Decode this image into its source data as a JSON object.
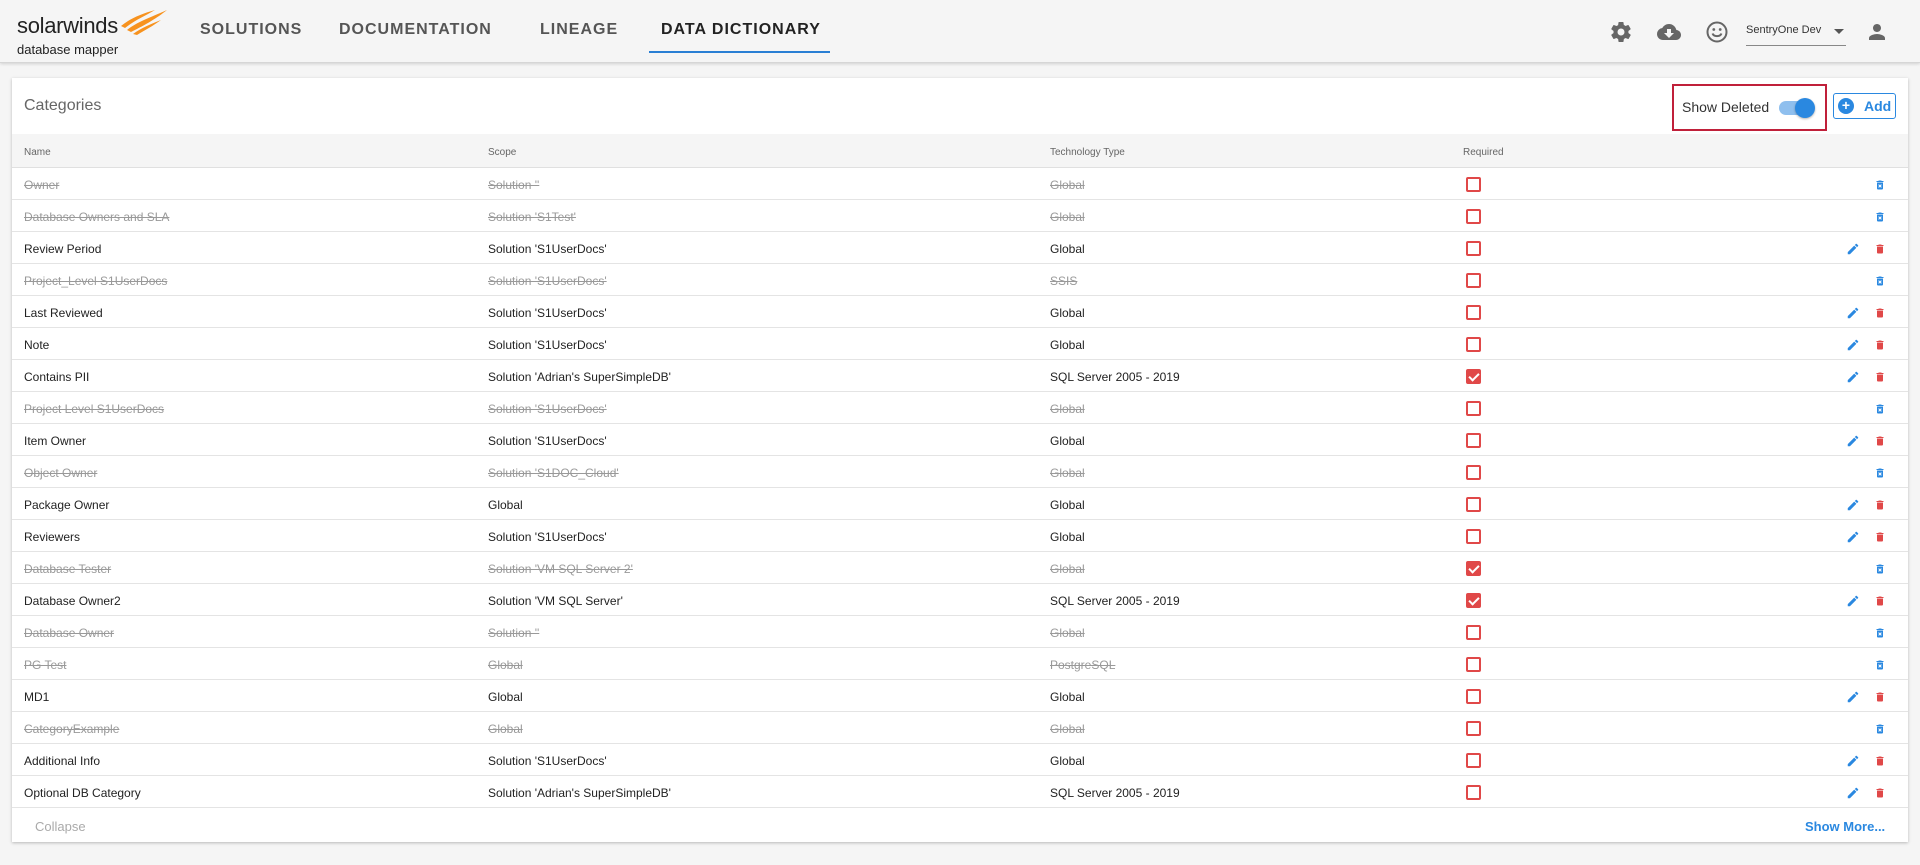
{
  "brand": {
    "name": "solarwinds",
    "product": "database mapper",
    "flame_color": "#f7921e"
  },
  "nav": {
    "items": [
      {
        "label": "SOLUTIONS"
      },
      {
        "label": "DOCUMENTATION"
      },
      {
        "label": "LINEAGE"
      },
      {
        "label": "DATA DICTIONARY",
        "active": true
      }
    ]
  },
  "topbar": {
    "icons": [
      "gear-icon",
      "cloud-download-icon",
      "smiley-icon",
      "person-icon"
    ],
    "user_select": "SentryOne Dev"
  },
  "categories": {
    "title": "Categories",
    "show_deleted_label": "Show Deleted",
    "show_deleted": true,
    "add_label": "Add",
    "columns": {
      "name": "Name",
      "scope": "Scope",
      "tech": "Technology Type",
      "required": "Required"
    },
    "rows": [
      {
        "name": "Owner",
        "scope": "Solution ''",
        "tech": "Global",
        "required": false,
        "deleted": true
      },
      {
        "name": "Database Owners and SLA",
        "scope": "Solution 'S1Test'",
        "tech": "Global",
        "required": false,
        "deleted": true
      },
      {
        "name": "Review Period",
        "scope": "Solution 'S1UserDocs'",
        "tech": "Global",
        "required": false,
        "deleted": false
      },
      {
        "name": "Project_Level S1UserDocs",
        "scope": "Solution 'S1UserDocs'",
        "tech": "SSIS",
        "required": false,
        "deleted": true
      },
      {
        "name": "Last Reviewed",
        "scope": "Solution 'S1UserDocs'",
        "tech": "Global",
        "required": false,
        "deleted": false
      },
      {
        "name": "Note",
        "scope": "Solution 'S1UserDocs'",
        "tech": "Global",
        "required": false,
        "deleted": false
      },
      {
        "name": "Contains PII",
        "scope": "Solution 'Adrian's SuperSimpleDB'",
        "tech": "SQL Server 2005 - 2019",
        "required": true,
        "deleted": false
      },
      {
        "name": "Project Level S1UserDocs",
        "scope": "Solution 'S1UserDocs'",
        "tech": "Global",
        "required": false,
        "deleted": true
      },
      {
        "name": "Item Owner",
        "scope": "Solution 'S1UserDocs'",
        "tech": "Global",
        "required": false,
        "deleted": false
      },
      {
        "name": "Object Owner",
        "scope": "Solution 'S1DOC_Cloud'",
        "tech": "Global",
        "required": false,
        "deleted": true
      },
      {
        "name": "Package Owner",
        "scope": "Global",
        "tech": "Global",
        "required": false,
        "deleted": false
      },
      {
        "name": "Reviewers",
        "scope": "Solution 'S1UserDocs'",
        "tech": "Global",
        "required": false,
        "deleted": false
      },
      {
        "name": "Database Tester",
        "scope": "Solution 'VM SQL Server 2'",
        "tech": "Global",
        "required": true,
        "deleted": true
      },
      {
        "name": "Database Owner2",
        "scope": "Solution 'VM SQL Server'",
        "tech": "SQL Server 2005 - 2019",
        "required": true,
        "deleted": false
      },
      {
        "name": "Database Owner",
        "scope": "Solution ''",
        "tech": "Global",
        "required": false,
        "deleted": true
      },
      {
        "name": "PG Test",
        "scope": "Global",
        "tech": "PostgreSQL",
        "required": false,
        "deleted": true
      },
      {
        "name": "MD1",
        "scope": "Global",
        "tech": "Global",
        "required": false,
        "deleted": false
      },
      {
        "name": "CategoryExample",
        "scope": "Global",
        "tech": "Global",
        "required": false,
        "deleted": true
      },
      {
        "name": "Additional Info",
        "scope": "Solution 'S1UserDocs'",
        "tech": "Global",
        "required": false,
        "deleted": false
      },
      {
        "name": "Optional DB Category",
        "scope": "Solution 'Adrian's SuperSimpleDB'",
        "tech": "SQL Server 2005 - 2019",
        "required": false,
        "deleted": false
      }
    ],
    "collapse_label": "Collapse",
    "show_more_label": "Show More..."
  },
  "colors": {
    "accent": "#2a88e0",
    "danger": "#e04848",
    "highlight_border": "#c0203a"
  }
}
